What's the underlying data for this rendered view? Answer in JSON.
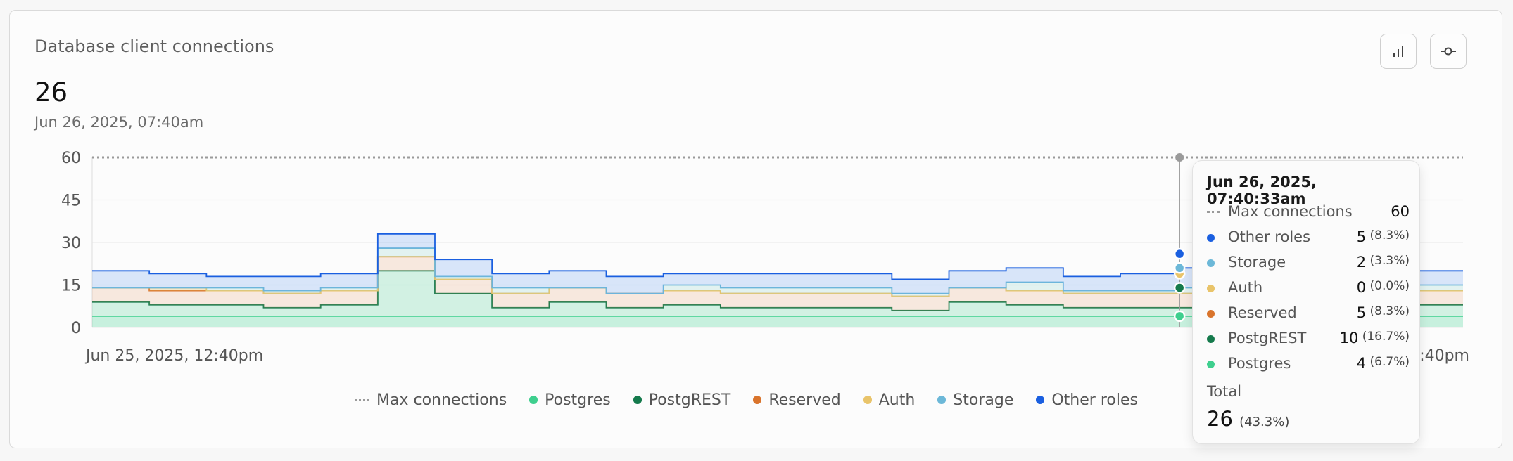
{
  "card": {
    "title": "Database client connections",
    "value": "26",
    "timestamp": "Jun 26, 2025, 07:40am"
  },
  "buttons": [
    {
      "name": "bar-chart-toggle-button",
      "icon": "bar-chart-icon"
    },
    {
      "name": "line-chart-toggle-button",
      "icon": "line-commit-icon"
    }
  ],
  "colors": {
    "postgres": "#3ecf8e",
    "postgrest": "#157a4c",
    "reserved": "#d9742c",
    "auth": "#e9c46a",
    "storage": "#6cb8d8",
    "other_roles": "#1a5fe0",
    "max": "#9a9a9a"
  },
  "chart_data": {
    "type": "area",
    "stacked": true,
    "step": true,
    "title": "Database client connections",
    "yticks": [
      0,
      15,
      30,
      45,
      60
    ],
    "ylim": [
      0,
      60
    ],
    "x_visible_labels": [
      "Jun 25, 2025, 12:40pm",
      ":40pm"
    ],
    "grid": true,
    "legend_position": "bottom",
    "max_connections": 60,
    "series": [
      {
        "name": "Postgres",
        "values": [
          4,
          4,
          4,
          4,
          4,
          4,
          4,
          4,
          4,
          4,
          4,
          4,
          4,
          4,
          4,
          4,
          4,
          4,
          4,
          4,
          4,
          4,
          4,
          4
        ]
      },
      {
        "name": "PostgREST",
        "values": [
          5,
          4,
          4,
          3,
          4,
          16,
          8,
          3,
          5,
          3,
          4,
          3,
          3,
          3,
          2,
          5,
          4,
          3,
          3,
          3,
          5,
          10,
          10,
          4
        ]
      },
      {
        "name": "Reserved",
        "values": [
          5,
          5,
          5,
          5,
          5,
          5,
          5,
          5,
          5,
          5,
          5,
          5,
          5,
          5,
          5,
          5,
          5,
          5,
          5,
          5,
          5,
          5,
          5,
          5
        ]
      },
      {
        "name": "Auth",
        "values": [
          0,
          1,
          0,
          0,
          0,
          0,
          0,
          0,
          0,
          0,
          0,
          0,
          0,
          0,
          0,
          0,
          0,
          0,
          0,
          0,
          0,
          0,
          0,
          0
        ]
      },
      {
        "name": "Storage",
        "values": [
          0,
          0,
          1,
          1,
          1,
          3,
          1,
          2,
          0,
          0,
          2,
          2,
          2,
          2,
          1,
          0,
          3,
          1,
          1,
          2,
          0,
          2,
          2,
          2
        ]
      },
      {
        "name": "Other roles",
        "values": [
          6,
          5,
          4,
          5,
          5,
          5,
          6,
          5,
          6,
          6,
          4,
          5,
          5,
          5,
          5,
          6,
          5,
          5,
          6,
          7,
          7,
          5,
          5,
          5
        ]
      }
    ],
    "max_series": {
      "name": "Max connections",
      "value": 60
    }
  },
  "legend": [
    {
      "label": "Max connections",
      "type": "dash"
    },
    {
      "label": "Postgres",
      "color": "#3ecf8e"
    },
    {
      "label": "PostgREST",
      "color": "#157a4c"
    },
    {
      "label": "Reserved",
      "color": "#d9742c"
    },
    {
      "label": "Auth",
      "color": "#e9c46a"
    },
    {
      "label": "Storage",
      "color": "#6cb8d8"
    },
    {
      "label": "Other roles",
      "color": "#1a5fe0"
    }
  ],
  "tooltip": {
    "title": "Jun 26, 2025, 07:40:33am",
    "rows": [
      {
        "label": "Max connections",
        "value": "60",
        "pct": "",
        "marker": "dash",
        "color": "#9a9a9a"
      },
      {
        "label": "Other roles",
        "value": "5",
        "pct": "(8.3%)",
        "marker": "dot",
        "color": "#1a5fe0"
      },
      {
        "label": "Storage",
        "value": "2",
        "pct": "(3.3%)",
        "marker": "dot",
        "color": "#6cb8d8"
      },
      {
        "label": "Auth",
        "value": "0",
        "pct": "(0.0%)",
        "marker": "dot",
        "color": "#e9c46a"
      },
      {
        "label": "Reserved",
        "value": "5",
        "pct": "(8.3%)",
        "marker": "dot",
        "color": "#d9742c"
      },
      {
        "label": "PostgREST",
        "value": "10",
        "pct": "(16.7%)",
        "marker": "dot",
        "color": "#157a4c"
      },
      {
        "label": "Postgres",
        "value": "4",
        "pct": "(6.7%)",
        "marker": "dot",
        "color": "#3ecf8e"
      }
    ],
    "total_label": "Total",
    "total_value": "26",
    "total_pct": "(43.3%)"
  }
}
